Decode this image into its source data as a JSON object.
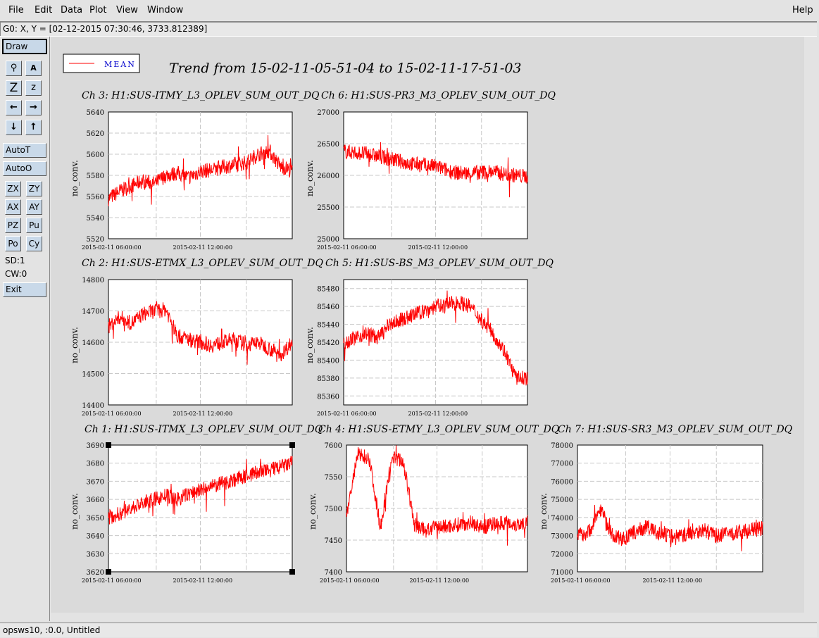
{
  "menubar": {
    "items": [
      "File",
      "Edit",
      "Data",
      "Plot",
      "View",
      "Window"
    ],
    "help": "Help"
  },
  "status": {
    "text": "G0: X, Y = [02-12-2015 07:30:46, 3733.812389]"
  },
  "toolbar": {
    "draw": "Draw",
    "icons": [
      "magnify-icon",
      "text-style-icon",
      "zoom-big-icon",
      "zoom-small-icon",
      "arrow-left-icon",
      "arrow-right-icon",
      "arrow-down-icon",
      "arrow-up-icon"
    ],
    "glyphs": [
      "⚲",
      "A",
      "Z",
      "z",
      "←",
      "→",
      "↓",
      "↑"
    ],
    "autot": "AutoT",
    "autoo": "AutoO",
    "grid_buttons": [
      "ZX",
      "ZY",
      "AX",
      "AY",
      "PZ",
      "Pu",
      "Po",
      "Cy"
    ],
    "sd": "SD:1",
    "cw": "CW:0",
    "exit": "Exit"
  },
  "footer": {
    "text": "opsws10, :0.0, Untitled"
  },
  "colors": {
    "trace": "#ff0000",
    "legend_text": "#0000cc"
  },
  "legend": {
    "label": "MEAN"
  },
  "title": "Trend from 15-02-11-05-51-04 to 15-02-11-17-51-03",
  "chart_data": [
    {
      "type": "line",
      "title": "Ch 3: H1:SUS-ITMY_L3_OPLEV_SUM_OUT_DQ",
      "ylabel": "no_conv.",
      "ylim": [
        5520,
        5640
      ],
      "yticks": [
        5520,
        5540,
        5560,
        5580,
        5600,
        5620,
        5640
      ],
      "xticklabels": [
        "2015-02-11 06:00:00",
        "2015-02-11 12:00:00"
      ],
      "series": [
        {
          "name": "MEAN",
          "values": [
            5558,
            5565,
            5570,
            5575,
            5572,
            5580,
            5582,
            5578,
            5584,
            5585,
            5588,
            5590,
            5592,
            5600,
            5603,
            5588,
            5585
          ]
        }
      ]
    },
    {
      "type": "line",
      "title": "Ch 6: H1:SUS-PR3_M3_OPLEV_SUM_OUT_DQ",
      "ylabel": "no_conv.",
      "ylim": [
        25000,
        27000
      ],
      "yticks": [
        25000,
        25500,
        26000,
        26500,
        27000
      ],
      "xticklabels": [
        "2015-02-11 06:00:00",
        "2015-02-11 12:00:00"
      ],
      "series": [
        {
          "name": "MEAN",
          "values": [
            26380,
            26360,
            26340,
            26300,
            26260,
            26220,
            26180,
            26160,
            26140,
            26080,
            26040,
            26030,
            26050,
            26060,
            26020,
            26000,
            25980
          ]
        }
      ]
    },
    {
      "type": "line",
      "title": "Ch 2: H1:SUS-ETMX_L3_OPLEV_SUM_OUT_DQ",
      "ylabel": "no_conv.",
      "ylim": [
        14400,
        14800
      ],
      "yticks": [
        14400,
        14500,
        14600,
        14700,
        14800
      ],
      "xticklabels": [
        "2015-02-11 06:00:00",
        "2015-02-11 12:00:00"
      ],
      "series": [
        {
          "name": "MEAN",
          "values": [
            14650,
            14680,
            14660,
            14690,
            14700,
            14705,
            14620,
            14610,
            14600,
            14590,
            14600,
            14610,
            14590,
            14600,
            14580,
            14560,
            14600
          ]
        }
      ]
    },
    {
      "type": "line",
      "title": "Ch 5: H1:SUS-BS_M3_OPLEV_SUM_OUT_DQ",
      "ylabel": "no_conv.",
      "ylim": [
        85350,
        85490
      ],
      "yticks": [
        85360,
        85380,
        85400,
        85420,
        85440,
        85460,
        85480
      ],
      "xticklabels": [
        "2015-02-11 06:00:00",
        "2015-02-11 12:00:00"
      ],
      "series": [
        {
          "name": "MEAN",
          "values": [
            85420,
            85425,
            85430,
            85425,
            85440,
            85445,
            85450,
            85455,
            85460,
            85462,
            85465,
            85460,
            85445,
            85430,
            85410,
            85380,
            85380
          ]
        }
      ]
    },
    {
      "type": "line",
      "title": "Ch 1: H1:SUS-ITMX_L3_OPLEV_SUM_OUT_DQ",
      "ylabel": "no_conv.",
      "ylim": [
        3620,
        3690
      ],
      "yticks": [
        3620,
        3630,
        3640,
        3650,
        3660,
        3670,
        3680,
        3690
      ],
      "xticklabels": [
        "2015-02-11 06:00:00",
        "2015-02-11 12:00:00"
      ],
      "series": [
        {
          "name": "MEAN",
          "values": [
            3650,
            3652,
            3655,
            3658,
            3660,
            3662,
            3660,
            3663,
            3665,
            3667,
            3669,
            3671,
            3673,
            3675,
            3676,
            3678,
            3680
          ]
        }
      ]
    },
    {
      "type": "line",
      "title": "Ch 4: H1:SUS-ETMY_L3_OPLEV_SUM_OUT_DQ",
      "ylabel": "no_conv.",
      "ylim": [
        7400,
        7600
      ],
      "yticks": [
        7400,
        7450,
        7500,
        7550,
        7600
      ],
      "xticklabels": [
        "2015-02-11 06:00:00",
        "2015-02-11 12:00:00"
      ],
      "series": [
        {
          "name": "MEAN",
          "values": [
            7490,
            7585,
            7580,
            7470,
            7580,
            7575,
            7475,
            7465,
            7470,
            7472,
            7475,
            7478,
            7470,
            7475,
            7478,
            7475,
            7478
          ]
        }
      ]
    },
    {
      "type": "line",
      "title": "Ch 7: H1:SUS-SR3_M3_OPLEV_SUM_OUT_DQ",
      "ylabel": "no_conv.",
      "ylim": [
        71000,
        78000
      ],
      "yticks": [
        71000,
        72000,
        73000,
        74000,
        75000,
        76000,
        77000,
        78000
      ],
      "xticklabels": [
        "2015-02-11 06:00:00",
        "2015-02-11 12:00:00"
      ],
      "series": [
        {
          "name": "MEAN",
          "values": [
            73000,
            73200,
            74500,
            73000,
            72800,
            73200,
            73500,
            73100,
            73000,
            73000,
            73200,
            73300,
            73000,
            73100,
            73200,
            73300,
            73400
          ]
        }
      ]
    }
  ]
}
